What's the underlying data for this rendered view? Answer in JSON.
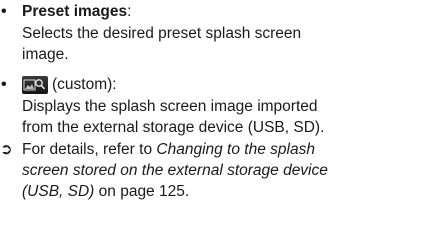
{
  "preset": {
    "bullet": "•",
    "title": "Preset images",
    "colon": ":",
    "description_lines": [
      "Selects the desired preset splash screen",
      "image."
    ]
  },
  "custom": {
    "bullet": "•",
    "icon": "custom-image-icon",
    "label": "(custom):",
    "description_lines": [
      "Displays the splash screen image imported",
      "from the external storage device (USB, SD)."
    ]
  },
  "note": {
    "arrow": "➲",
    "line1_plain": "For details, refer to ",
    "line1_italic": "Changing to the splash",
    "line2_italic": "screen stored on the external storage device",
    "line3_italic": "(USB, SD)",
    "line3_plain": " on page 125."
  }
}
